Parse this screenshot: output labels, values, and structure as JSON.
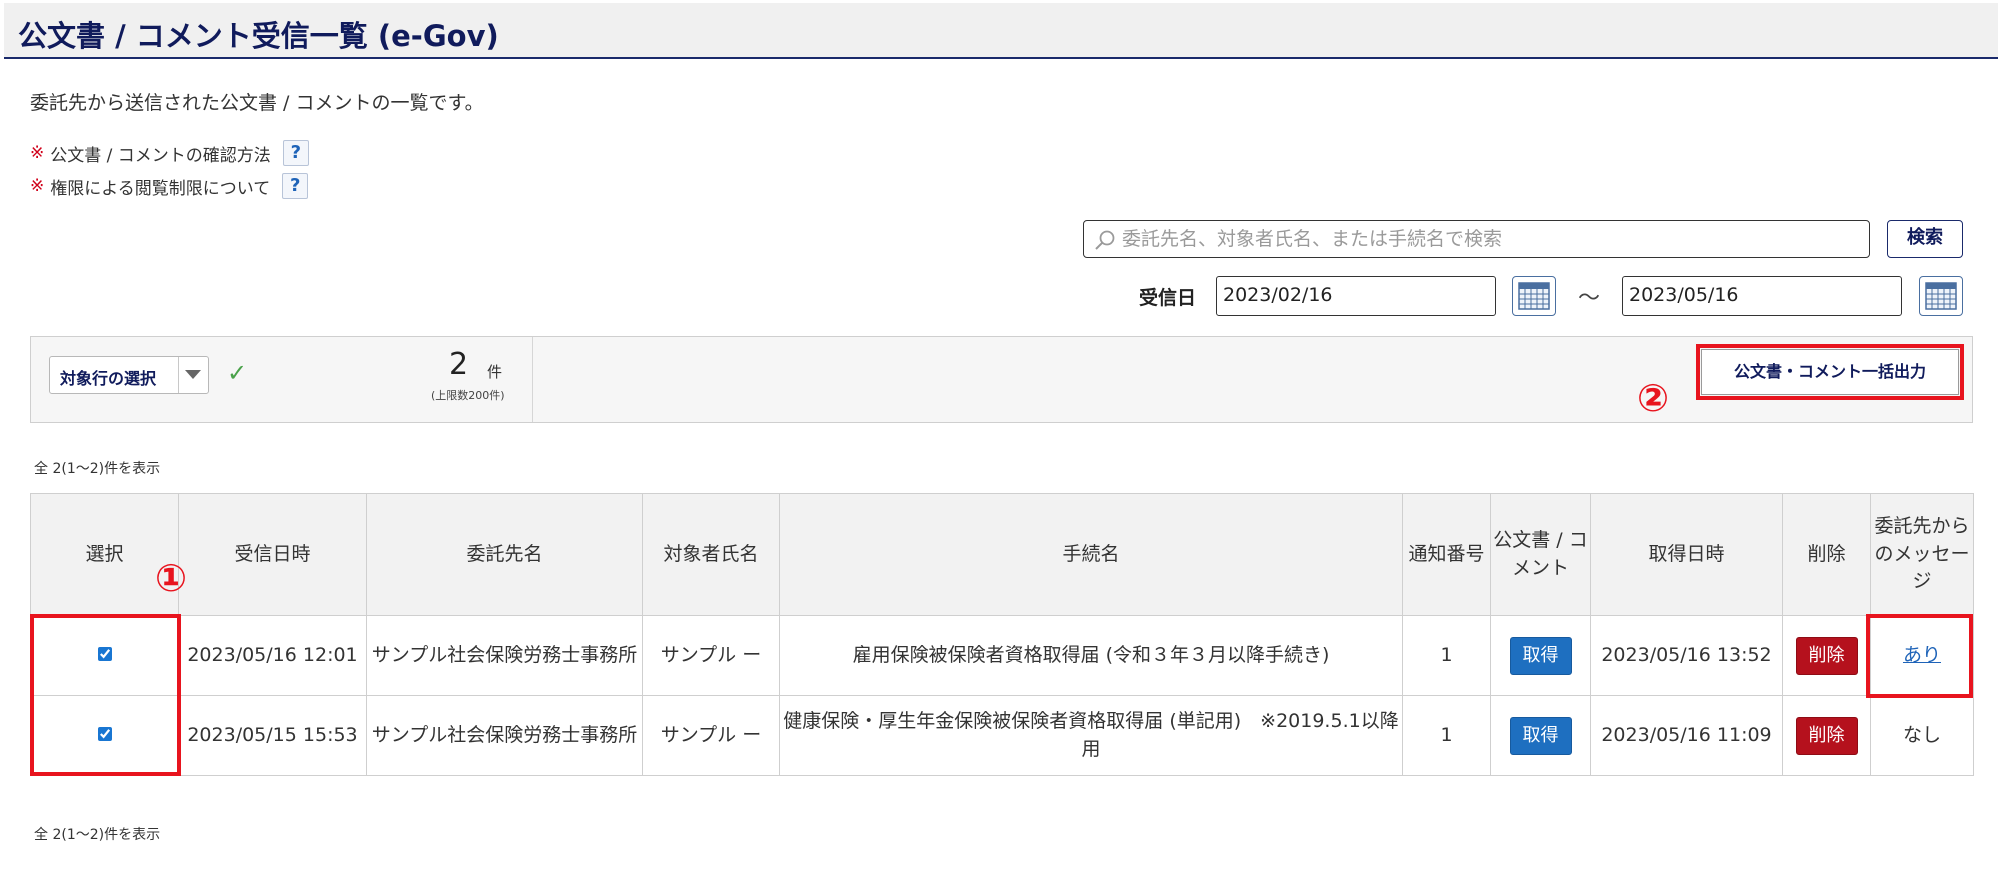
{
  "header": {
    "title": "公文書 / コメント受信一覧 (e-Gov)"
  },
  "description": "委託先から送信された公文書 / コメントの一覧です。",
  "notes": [
    {
      "mark": "※",
      "text": "公文書 / コメントの確認方法",
      "help": "?"
    },
    {
      "mark": "※",
      "text": "権限による閲覧制限について",
      "help": "?"
    }
  ],
  "search": {
    "placeholder": "委託先名、対象者氏名、または手続名で検索",
    "value": "",
    "button_label": "検索"
  },
  "date_filter": {
    "label": "受信日",
    "from": "2023/02/16",
    "separator": "～",
    "to": "2023/05/16"
  },
  "toolbar": {
    "select_label": "対象行の選択",
    "selected_count": "2",
    "count_unit": "件",
    "limit_text": "(上限数200件)",
    "bulk_export_label": "公文書・コメント一括出力"
  },
  "annotations": {
    "first": "①",
    "second": "②"
  },
  "result_count_top": "全 2(1～2)件を表示",
  "result_count_bottom": "全 2(1～2)件を表示",
  "table": {
    "headers": {
      "select": "選択",
      "received": "受信日時",
      "contractor": "委託先名",
      "person": "対象者氏名",
      "procedure": "手続名",
      "notice_no": "通知番号",
      "document": "公文書 / コメント",
      "acquired": "取得日時",
      "delete": "削除",
      "message": "委託先からのメッセージ"
    },
    "rows": [
      {
        "checked": true,
        "received": "2023/05/16 12:01",
        "contractor": "サンプル社会保険労務士事務所",
        "person": "サンプル ー",
        "procedure": "雇用保険被保険者資格取得届 (令和３年３月以降手続き)",
        "notice_no": "1",
        "get_label": "取得",
        "acquired": "2023/05/16 13:52",
        "delete_label": "削除",
        "message": "あり"
      },
      {
        "checked": true,
        "received": "2023/05/15 15:53",
        "contractor": "サンプル社会保険労務士事務所",
        "person": "サンプル ー",
        "procedure": "健康保険・厚生年金保険被保険者資格取得届 (単記用)　※2019.5.1以降用",
        "notice_no": "1",
        "get_label": "取得",
        "acquired": "2023/05/16 11:09",
        "delete_label": "削除",
        "message": "なし"
      }
    ]
  }
}
